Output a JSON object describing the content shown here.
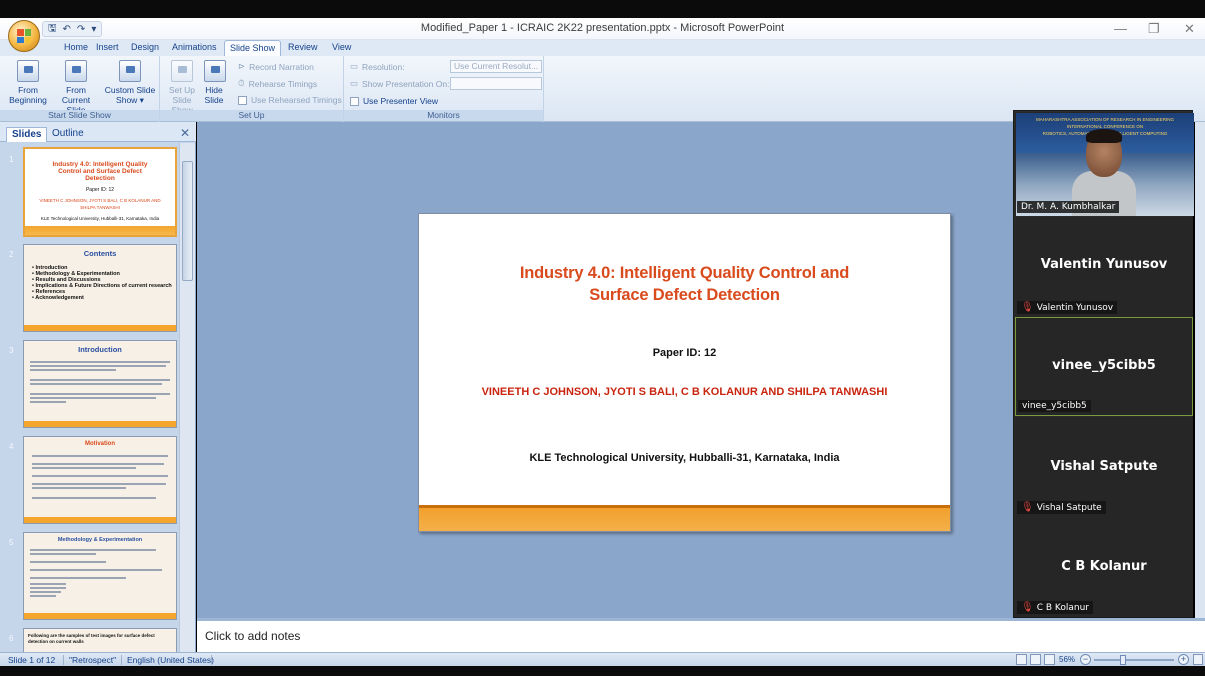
{
  "window": {
    "title": "Modified_Paper 1 - ICRAIC 2K22 presentation.pptx - Microsoft PowerPoint",
    "controls": [
      "—",
      "❐",
      "✕"
    ]
  },
  "qat": {
    "save": "🖫",
    "undo": "↶",
    "redo": "↷",
    "more": "▾"
  },
  "tabs": [
    "Home",
    "Insert",
    "Design",
    "Animations",
    "Slide Show",
    "Review",
    "View"
  ],
  "active_tab": "Slide Show",
  "ribbon": {
    "start": {
      "label": "Start Slide Show",
      "from_beginning": "From Beginning",
      "from_current": "From Current Slide",
      "custom": "Custom Slide Show ▾"
    },
    "setup": {
      "label": "Set Up",
      "setup_show": "Set Up Slide Show",
      "hide_slide": "Hide Slide",
      "record_narration": "Record Narration",
      "rehearse_timings": "Rehearse Timings",
      "use_rehearsed": "Use Rehearsed Timings"
    },
    "monitors": {
      "label": "Monitors",
      "resolution": "Resolution:",
      "resolution_value": "Use Current Resolut...",
      "show_on": "Show Presentation On:",
      "presenter_view": "Use Presenter View"
    }
  },
  "pane": {
    "tab_slides": "Slides",
    "tab_outline": "Outline",
    "close": "✕",
    "thumbs": [
      {
        "num": "1",
        "title": "Industry 4.0: Intelligent Quality Control and Surface Defect Detection",
        "sub1": "Paper ID: 12",
        "sub2": "VINEETH C JOHNSON, JYOTI S BALI, C B KOLANUR AND SHILPA TANWASHI",
        "sub3": "KLE Technological University, Hubballi-31, Karnataka, India"
      },
      {
        "num": "2",
        "title": "Contents",
        "bullets": [
          "Introduction",
          "Methodology & Experimentation",
          "Results and Discussions",
          "Implications & Future Directions of current research",
          "References",
          "Acknowledgement"
        ]
      },
      {
        "num": "3",
        "title": "Introduction"
      },
      {
        "num": "4",
        "title": "Motivation"
      },
      {
        "num": "5",
        "title": "Methodology & Experimentation"
      },
      {
        "num": "6",
        "title": "Following are the samples of test images for surface defect detection on current walls"
      }
    ]
  },
  "slide": {
    "title_line1": "Industry 4.0: Intelligent Quality Control and",
    "title_line2": "Surface Defect Detection",
    "paper_id": "Paper ID: 12",
    "authors": "VINEETH C JOHNSON, JYOTI S BALI, C B KOLANUR AND SHILPA TANWASHI",
    "university": "KLE Technological University, Hubballi-31, Karnataka, India"
  },
  "notes_placeholder": "Click to add notes",
  "participants": [
    {
      "name": "",
      "label": "Dr. M. A. Kumbhalkar",
      "video": true,
      "muted": false
    },
    {
      "name": "Valentin Yunusov",
      "label": "Valentin Yunusov",
      "muted": true
    },
    {
      "name": "vinee_y5cibb5",
      "label": "vinee_y5cibb5",
      "muted": false,
      "active": true
    },
    {
      "name": "Vishal Satpute",
      "label": "Vishal Satpute",
      "muted": true
    },
    {
      "name": "C B Kolanur",
      "label": "C B Kolanur",
      "muted": true
    }
  ],
  "banner_text": [
    "MAHARASHTRA ASSOCIATION OF RESEARCH IN ENGINEERING",
    "INTERNATIONAL CONFERENCE ON",
    "ROBOTICS, AUTOMATION AND INTELLIGENT COMPUTING"
  ],
  "status": {
    "slide_of": "Slide 1 of 12",
    "theme": "\"Retrospect\"",
    "language": "English (United States)",
    "zoom": "56%",
    "zoom_minus": "−",
    "zoom_plus": "+"
  }
}
